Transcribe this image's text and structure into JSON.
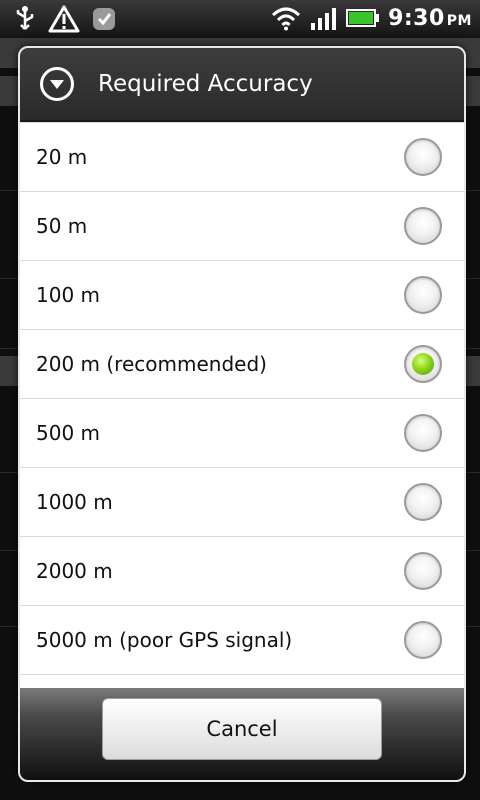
{
  "status_bar": {
    "icons_left": [
      "usb-icon",
      "warning-icon",
      "sync-icon"
    ],
    "icons_right": [
      "wifi-icon",
      "signal-icon",
      "battery-icon"
    ],
    "time": "9:30",
    "ampm": "PM"
  },
  "dialog": {
    "title": "Required Accuracy",
    "options": [
      {
        "label": "20 m",
        "selected": false
      },
      {
        "label": "50 m",
        "selected": false
      },
      {
        "label": "100 m",
        "selected": false
      },
      {
        "label": "200 m (recommended)",
        "selected": true
      },
      {
        "label": "500 m",
        "selected": false
      },
      {
        "label": "1000 m",
        "selected": false
      },
      {
        "label": "2000 m",
        "selected": false
      },
      {
        "label": "5000 m (poor GPS signal)",
        "selected": false
      }
    ],
    "cancel_label": "Cancel"
  },
  "colors": {
    "selected_radio": "#8fd61a",
    "title_bar": "#333333",
    "dialog_bg": "#ffffff"
  }
}
